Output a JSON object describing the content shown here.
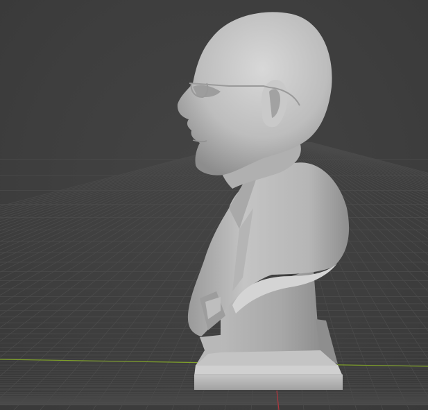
{
  "viewport": {
    "background_color": "#3d3d3d",
    "grid_color": "#4b4b4b",
    "x_axis_color": "#7fa02a",
    "y_axis_color": "#b2363e",
    "model_color": "#c2c2c2",
    "icons": {
      "model": "bust-sculpture-icon"
    }
  }
}
